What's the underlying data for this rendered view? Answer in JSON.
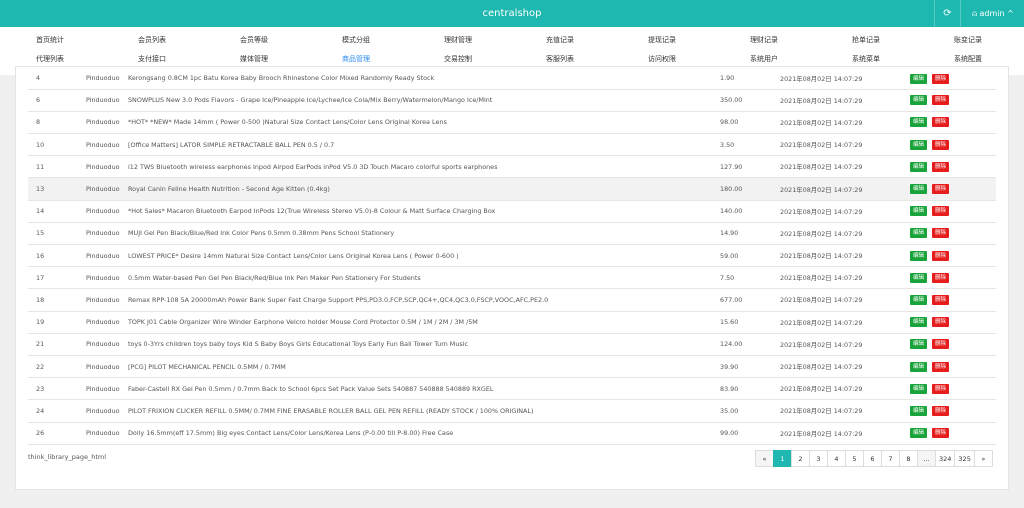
{
  "header": {
    "title": "centralshop",
    "refresh_icon": "refresh-icon",
    "user_icon": "user-icon",
    "user_label": "admin",
    "caret_icon": "chevron-up-icon",
    "color": "#1fb8b0"
  },
  "nav": {
    "row1": [
      "首页统计",
      "会员列表",
      "会员等级",
      "模式分组",
      "理财管理",
      "充值记录",
      "提现记录",
      "理财记录",
      "抢单记录",
      "账变记录"
    ],
    "row2": [
      "代理列表",
      "支付接口",
      "媒体管理",
      "商品管理",
      "交易控制",
      "客服列表",
      "访问权限",
      "系统用户",
      "系统菜单",
      "系统配置"
    ],
    "active": "商品管理",
    "active_color": "#2d8cf0"
  },
  "table": {
    "rows": [
      {
        "id": "4",
        "source": "Pinduoduo",
        "title": "Kerongsang 0.8CM 1pc Batu Korea Baby Brooch Rhinestone Color Mixed Randomly Ready Stock",
        "price": "1.90",
        "time": "2021年08月02日 14:07:29"
      },
      {
        "id": "6",
        "source": "Pinduoduo",
        "title": "SNOWPLUS New 3.0 Pods Flavors - Grape Ice/Pineapple Ice/Lychee/Ice Cola/Mix Berry/Watermelon/Mango Ice/Mint",
        "price": "350.00",
        "time": "2021年08月02日 14:07:29"
      },
      {
        "id": "8",
        "source": "Pinduoduo",
        "title": "*HOT* *NEW* Made 14mm ( Power 0-500 )Natural Size Contact Lens/Color Lens Original Korea Lens",
        "price": "98.00",
        "time": "2021年08月02日 14:07:29"
      },
      {
        "id": "10",
        "source": "Pinduoduo",
        "title": "[Office Matters] LATOR SIMPLE RETRACTABLE BALL PEN 0.5 / 0.7",
        "price": "3.50",
        "time": "2021年08月02日 14:07:29"
      },
      {
        "id": "11",
        "source": "Pinduoduo",
        "title": "i12 TWS Bluetooth wireless earphones Inpod Airpod EarPods inPod V5.0 3D Touch Macaro colorful sports earphones",
        "price": "127.90",
        "time": "2021年08月02日 14:07:29"
      },
      {
        "id": "13",
        "source": "Pinduoduo",
        "title": "Royal Canin Feline Health Nutrition - Second Age Kitten (0.4kg)",
        "price": "180.00",
        "time": "2021年08月02日 14:07:29"
      },
      {
        "id": "14",
        "source": "Pinduoduo",
        "title": "*Hot Sales* Macaron Bluetooth Earpod InPods 12(True Wireless Stereo V5.0)-8 Colour & Matt Surface Charging Box",
        "price": "140.00",
        "time": "2021年08月02日 14:07:29"
      },
      {
        "id": "15",
        "source": "Pinduoduo",
        "title": "MUJI Gel Pen Black/Blue/Red Ink Color Pens 0.5mm 0.38mm Pens School Stationery",
        "price": "14.90",
        "time": "2021年08月02日 14:07:29"
      },
      {
        "id": "16",
        "source": "Pinduoduo",
        "title": "LOWEST PRICE* Desire 14mm Natural Size Contact Lens/Color Lens Original Korea Lens ( Power 0-600 )",
        "price": "59.00",
        "time": "2021年08月02日 14:07:29"
      },
      {
        "id": "17",
        "source": "Pinduoduo",
        "title": "0.5mm Water-based Pen Gel Pen Black/Red/Blue Ink Pen Maker Pen Stationery For Students",
        "price": "7.50",
        "time": "2021年08月02日 14:07:29"
      },
      {
        "id": "18",
        "source": "Pinduoduo",
        "title": "Remax RPP-108 5A 20000mAh Power Bank Super Fast Charge Support PPS,PD3.0,FCP,SCP,QC4+,QC4,QC3.0,FSCP,VOOC,AFC,PE2.0",
        "price": "677.00",
        "time": "2021年08月02日 14:07:29"
      },
      {
        "id": "19",
        "source": "Pinduoduo",
        "title": "TOPK J01 Cable Organizer Wire Winder Earphone Velcro holder Mouse Cord Protector 0.5M / 1M / 2M / 3M /5M",
        "price": "15.60",
        "time": "2021年08月02日 14:07:29"
      },
      {
        "id": "21",
        "source": "Pinduoduo",
        "title": "toys 0-3Yrs children toys baby toys Kid S Baby Boys Girls Educational Toys Early Fun Ball Tower Turn Music",
        "price": "124.00",
        "time": "2021年08月02日 14:07:29"
      },
      {
        "id": "22",
        "source": "Pinduoduo",
        "title": "[PCG] PILOT MECHANICAL PENCIL 0.5MM / 0.7MM",
        "price": "39.90",
        "time": "2021年08月02日 14:07:29"
      },
      {
        "id": "23",
        "source": "Pinduoduo",
        "title": "Faber-Castell RX Gel Pen 0.5mm / 0.7mm Back to School 6pcs Set Pack Value Sets 540887 540888 540889 RXGEL",
        "price": "83.90",
        "time": "2021年08月02日 14:07:29"
      },
      {
        "id": "24",
        "source": "Pinduoduo",
        "title": "PILOT FRIXION CLICKER REFILL 0.5MM/ 0.7MM FINE ERASABLE ROLLER BALL GEL PEN REFILL (READY STOCK / 100% ORIGINAL)",
        "price": "35.00",
        "time": "2021年08月02日 14:07:29"
      },
      {
        "id": "26",
        "source": "Pinduoduo",
        "title": "Dolly 16.5mm(eff 17.5mm) Big eyes Contact Lens/Color Lens/Korea Lens (P-0.00 till P-8.00) Free Case",
        "price": "99.00",
        "time": "2021年08月02日 14:07:29"
      }
    ],
    "edit_label": "编辑",
    "delete_label": "删除",
    "edit_color": "#1aa33a",
    "delete_color": "#e51d1d"
  },
  "footer": {
    "text": "think_library_page_html"
  },
  "pagination": {
    "prev": "«",
    "pages": [
      "1",
      "2",
      "3",
      "4",
      "5",
      "6",
      "7",
      "8",
      "...",
      "324",
      "325"
    ],
    "next": "»",
    "current": "1"
  }
}
